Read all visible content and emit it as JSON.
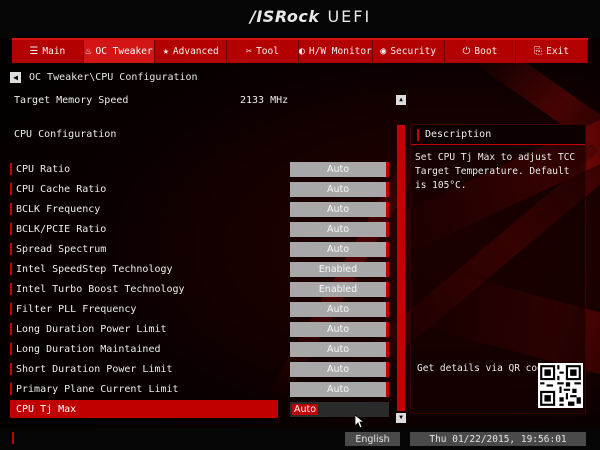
{
  "brand": {
    "name": "/ISRock",
    "product": "UEFI"
  },
  "nav": [
    {
      "label": "Main",
      "icon": "list-icon",
      "glyph": "☰"
    },
    {
      "label": "OC Tweaker",
      "icon": "flame-icon",
      "glyph": "♨"
    },
    {
      "label": "Advanced",
      "icon": "star-icon",
      "glyph": "★"
    },
    {
      "label": "Tool",
      "icon": "tool-icon",
      "glyph": "✂"
    },
    {
      "label": "H/W Monitor",
      "icon": "monitor-icon",
      "glyph": "◐"
    },
    {
      "label": "Security",
      "icon": "shield-icon",
      "glyph": "◉"
    },
    {
      "label": "Boot",
      "icon": "power-icon",
      "glyph": "⏻"
    },
    {
      "label": "Exit",
      "icon": "exit-icon",
      "glyph": "⎘"
    }
  ],
  "breadcrumb": "OC Tweaker\\CPU Configuration",
  "target_memory": {
    "label": "Target Memory Speed",
    "value": "2133 MHz"
  },
  "section_title": "CPU Configuration",
  "settings": [
    {
      "label": "CPU Ratio",
      "value": "Auto"
    },
    {
      "label": "CPU Cache Ratio",
      "value": "Auto"
    },
    {
      "label": "BCLK Frequency",
      "value": "Auto"
    },
    {
      "label": "BCLK/PCIE Ratio",
      "value": "Auto"
    },
    {
      "label": "Spread Spectrum",
      "value": "Auto"
    },
    {
      "label": "Intel SpeedStep Technology",
      "value": "Enabled"
    },
    {
      "label": "Intel Turbo Boost Technology",
      "value": "Enabled"
    },
    {
      "label": "Filter PLL Frequency",
      "value": "Auto"
    },
    {
      "label": "Long Duration Power Limit",
      "value": "Auto"
    },
    {
      "label": "Long Duration Maintained",
      "value": "Auto"
    },
    {
      "label": "Short Duration Power Limit",
      "value": "Auto"
    },
    {
      "label": "Primary Plane Current Limit",
      "value": "Auto"
    },
    {
      "label": "CPU Tj Max",
      "value": "Auto"
    }
  ],
  "description": {
    "title": "Description",
    "text": "Set CPU Tj Max to adjust TCC Target Temperature. Default is 105°C.",
    "qr_label": "Get details via QR code"
  },
  "footer": {
    "language": "English",
    "datetime": "Thu 01/22/2015, 19:56:01"
  },
  "colors": {
    "accent": "#c40000",
    "nav": "#b30000",
    "value_box": "#a8a8a8"
  }
}
